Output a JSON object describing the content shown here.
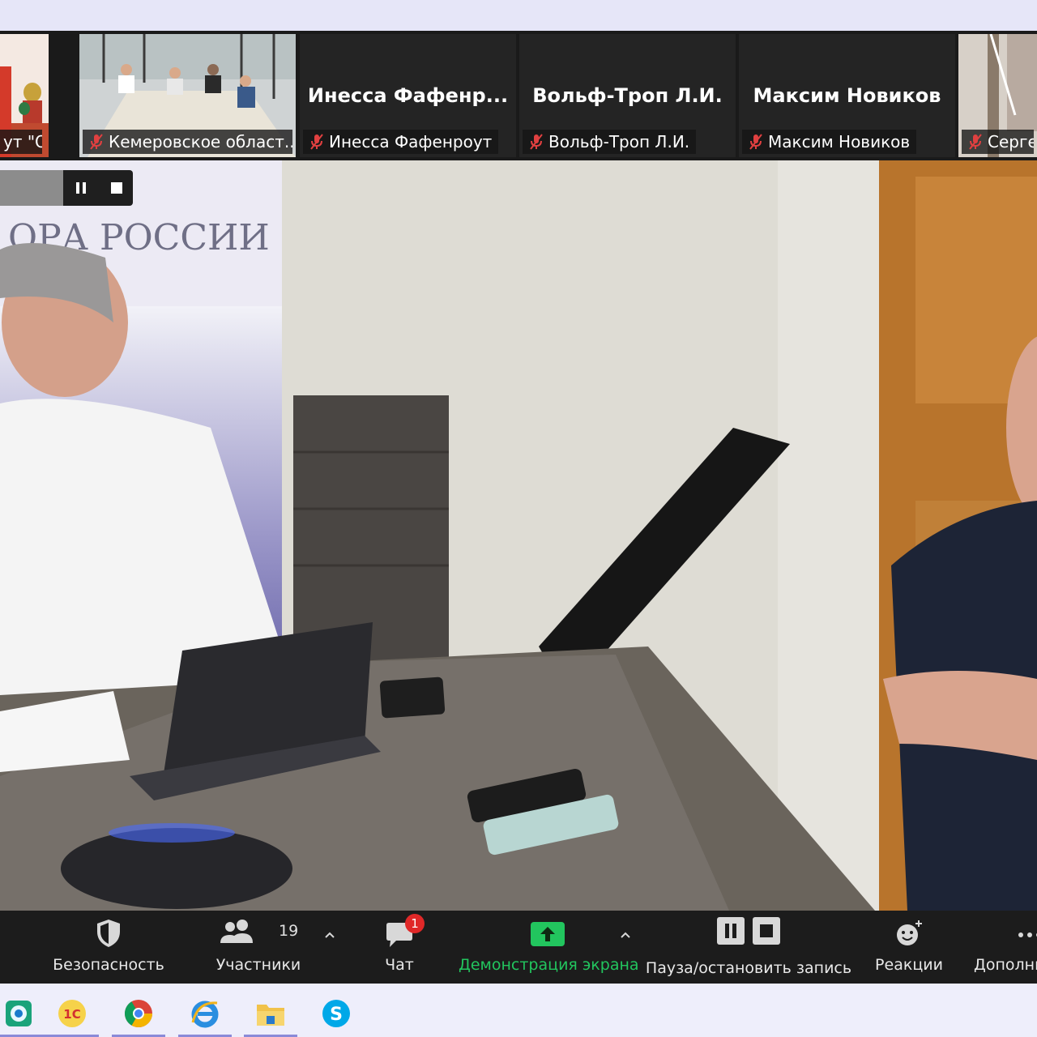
{
  "participants": [
    {
      "tile_title": "",
      "name_tag": "ут \"ОП...",
      "has_video": true,
      "muted": false
    },
    {
      "tile_title": "",
      "name_tag": "Кемеровское област...",
      "has_video": true,
      "muted": true
    },
    {
      "tile_title": "Инесса  Фафенр...",
      "name_tag": "Инесса Фафенроут",
      "has_video": false,
      "muted": true
    },
    {
      "tile_title": "Вольф-Троп Л.И.",
      "name_tag": "Вольф-Троп Л.И.",
      "has_video": false,
      "muted": true
    },
    {
      "tile_title": "Максим Новиков",
      "name_tag": "Максим Новиков",
      "has_video": false,
      "muted": true
    },
    {
      "tile_title": "",
      "name_tag": "Серге",
      "has_video": true,
      "muted": true
    }
  ],
  "main_video": {
    "banner_text": "ОРА РОССИИ",
    "recording_controls": {
      "pause_icon": "pause-icon",
      "stop_icon": "stop-icon"
    }
  },
  "toolbar": {
    "security_label": "Безопасность",
    "participants_label": "Участники",
    "participants_count": "19",
    "chat_label": "Чат",
    "chat_badge": "1",
    "share_label": "Демонстрация экрана",
    "record_label": "Пауза/остановить запись",
    "reactions_label": "Реакции",
    "more_label": "Дополни"
  },
  "taskbar": {
    "apps": [
      {
        "name": "network-app-icon"
      },
      {
        "name": "1c-icon"
      },
      {
        "name": "chrome-icon"
      },
      {
        "name": "internet-explorer-icon"
      },
      {
        "name": "file-explorer-icon"
      },
      {
        "name": "skype-icon"
      }
    ]
  },
  "colors": {
    "toolbar_bg": "#1c1c1c",
    "share_green": "#22c55e",
    "badge_red": "#e02828",
    "mute_red": "#e04040",
    "taskbar_bg": "#eeeefb",
    "top_strip": "#e6e6f8"
  }
}
